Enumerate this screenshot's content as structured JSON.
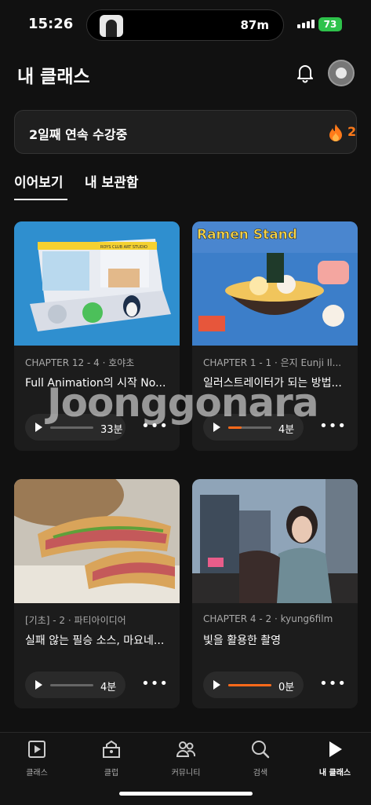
{
  "status_bar": {
    "time": "15:26",
    "distance": "87m",
    "battery": "73"
  },
  "header": {
    "title": "내 클래스"
  },
  "streak": {
    "text": "2일째 연속 수강중",
    "count": "2"
  },
  "tabs": [
    {
      "label": "이어보기",
      "active": true
    },
    {
      "label": "내 보관함",
      "active": false
    }
  ],
  "cards": [
    {
      "meta": "CHAPTER 12 - 4 · 호야초",
      "title": "Full Animation의 시작 No...",
      "duration": "33분",
      "progress": 0.0,
      "thumb_text": "ROYS CLUB ART STUDIO"
    },
    {
      "meta": "CHAPTER 1 - 1 · 은지 Eunji Il...",
      "title": "일러스트레이터가 되는 방법...",
      "duration": "4분",
      "progress": 0.3,
      "thumb_text": "Ramen Stand"
    },
    {
      "meta": "[기초] - 2 · 파티아이디어",
      "title": "실패 않는 필승 소스, 마요네...",
      "duration": "4분",
      "progress": 0.0
    },
    {
      "meta": "CHAPTER 4 - 2 · kyung6film",
      "title": "빛을 활용한 촬영",
      "duration": "0분",
      "progress": 1.0
    }
  ],
  "watermark": "Joonggonara",
  "bottom_nav": [
    {
      "label": "클래스",
      "icon": "play-square-icon"
    },
    {
      "label": "클럽",
      "icon": "club-icon"
    },
    {
      "label": "커뮤니티",
      "icon": "people-icon"
    },
    {
      "label": "검색",
      "icon": "search-icon"
    },
    {
      "label": "내 클래스",
      "icon": "play-icon",
      "active": true
    }
  ],
  "colors": {
    "accent": "#ff6a1a",
    "background": "#111111",
    "card": "#1c1c1c"
  }
}
